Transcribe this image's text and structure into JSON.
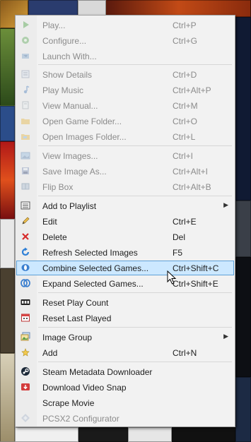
{
  "menu": {
    "items": [
      {
        "label": "Play...",
        "shortcut": "Ctrl+P",
        "icon": "play-icon",
        "disabled": true
      },
      {
        "label": "Configure...",
        "shortcut": "Ctrl+G",
        "icon": "configure-icon",
        "disabled": true
      },
      {
        "label": "Launch With...",
        "shortcut": "",
        "icon": "launch-with-icon",
        "disabled": true
      },
      {
        "label": "Show Details",
        "shortcut": "Ctrl+D",
        "icon": "details-icon",
        "disabled": true
      },
      {
        "label": "Play Music",
        "shortcut": "Ctrl+Alt+P",
        "icon": "music-note-icon",
        "disabled": true
      },
      {
        "label": "View Manual...",
        "shortcut": "Ctrl+M",
        "icon": "manual-icon",
        "disabled": true
      },
      {
        "label": "Open Game Folder...",
        "shortcut": "Ctrl+O",
        "icon": "folder-icon",
        "disabled": true
      },
      {
        "label": "Open Images Folder...",
        "shortcut": "Ctrl+L",
        "icon": "images-folder-icon",
        "disabled": true
      },
      {
        "label": "View Images...",
        "shortcut": "Ctrl+I",
        "icon": "view-images-icon",
        "disabled": true
      },
      {
        "label": "Save Image As...",
        "shortcut": "Ctrl+Alt+I",
        "icon": "save-disk-icon",
        "disabled": true
      },
      {
        "label": "Flip Box",
        "shortcut": "Ctrl+Alt+B",
        "icon": "flip-box-icon",
        "disabled": true
      },
      {
        "label": "Add to Playlist",
        "shortcut": "",
        "icon": "playlist-icon",
        "disabled": false,
        "submenu": true
      },
      {
        "label": "Edit",
        "shortcut": "Ctrl+E",
        "icon": "pencil-icon",
        "disabled": false
      },
      {
        "label": "Delete",
        "shortcut": "Del",
        "icon": "delete-x-icon",
        "disabled": false
      },
      {
        "label": "Refresh Selected Images",
        "shortcut": "F5",
        "icon": "refresh-icon",
        "disabled": false
      },
      {
        "label": "Combine Selected Games...",
        "shortcut": "Ctrl+Shift+C",
        "icon": "combine-icon",
        "disabled": false,
        "highlighted": true
      },
      {
        "label": "Expand Selected Games...",
        "shortcut": "Ctrl+Shift+E",
        "icon": "expand-icon",
        "disabled": false
      },
      {
        "label": "Reset Play Count",
        "shortcut": "",
        "icon": "counter-icon",
        "disabled": false
      },
      {
        "label": "Reset Last Played",
        "shortcut": "",
        "icon": "calendar-icon",
        "disabled": false
      },
      {
        "label": "Image Group",
        "shortcut": "",
        "icon": "image-group-icon",
        "disabled": false,
        "submenu": true
      },
      {
        "label": "Add",
        "shortcut": "Ctrl+N",
        "icon": "add-star-icon",
        "disabled": false
      },
      {
        "label": "Steam Metadata Downloader",
        "shortcut": "",
        "icon": "steam-icon",
        "disabled": false
      },
      {
        "label": "Download Video Snap",
        "shortcut": "",
        "icon": "download-video-icon",
        "disabled": false
      },
      {
        "label": "Scrape Movie",
        "shortcut": "",
        "icon": "",
        "disabled": false
      },
      {
        "label": "PCSX2 Configurator",
        "shortcut": "",
        "icon": "pcsx2-icon",
        "disabled": true
      }
    ],
    "submenu_arrow": "▶"
  },
  "colors": {
    "highlight_bg": "#cce8ff",
    "highlight_border": "#5ea0d6",
    "disabled_text": "#8b8b8b",
    "menu_bg": "#f2f2f2"
  }
}
